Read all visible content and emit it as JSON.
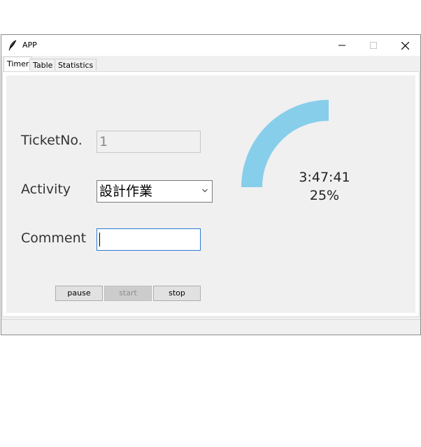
{
  "window": {
    "title": "APP",
    "app_icon": "feather-icon",
    "controls": [
      "minimize-icon",
      "maximize-icon",
      "close-icon"
    ]
  },
  "tabs": [
    {
      "label": "Timer",
      "active": true
    },
    {
      "label": "Table",
      "active": false
    },
    {
      "label": "Statistics",
      "active": false
    }
  ],
  "form": {
    "ticket_label": "TicketNo.",
    "ticket_value": "1",
    "activity_label": "Activity",
    "activity_value": "設計作業",
    "comment_label": "Comment",
    "comment_value": ""
  },
  "buttons": {
    "pause": "pause",
    "start": "start",
    "stop": "stop"
  },
  "gauge": {
    "time": "3:47:41",
    "percent_label": "25%",
    "progress": 0.25,
    "color": "#87ceeb"
  }
}
